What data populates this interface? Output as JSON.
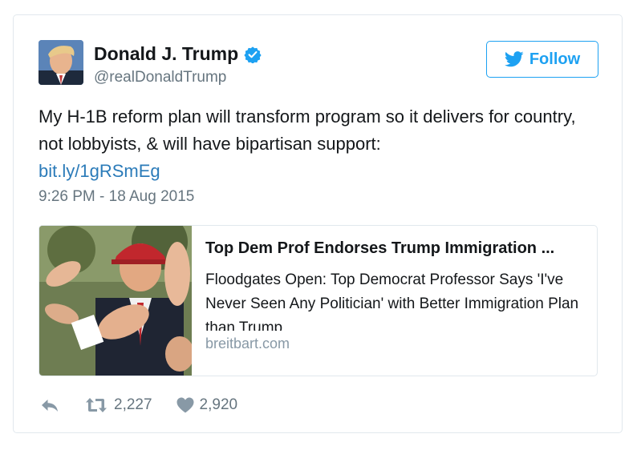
{
  "author": {
    "name": "Donald J. Trump",
    "handle": "@realDonaldTrump",
    "verified": true
  },
  "follow_button": {
    "label": "Follow"
  },
  "tweet": {
    "text": "My H-1B reform plan will transform program so it delivers for country, not lobbyists, & will have bipartisan support:",
    "link": "bit.ly/1gRSmEg",
    "timestamp": "9:26 PM - 18 Aug 2015"
  },
  "link_card": {
    "title": "Top Dem Prof Endorses Trump Immigration ...",
    "description": "Floodgates Open: Top Democrat Professor Says 'I've Never Seen Any Politician' with Better Immigration Plan than Trump",
    "domain": "breitbart.com"
  },
  "actions": {
    "reply_icon": "reply-icon",
    "retweet_count": "2,227",
    "like_count": "2,920"
  },
  "colors": {
    "accent": "#1da1f2",
    "link": "#2b7bb9",
    "secondary_text": "#66757f",
    "border": "#e1e8ed"
  }
}
